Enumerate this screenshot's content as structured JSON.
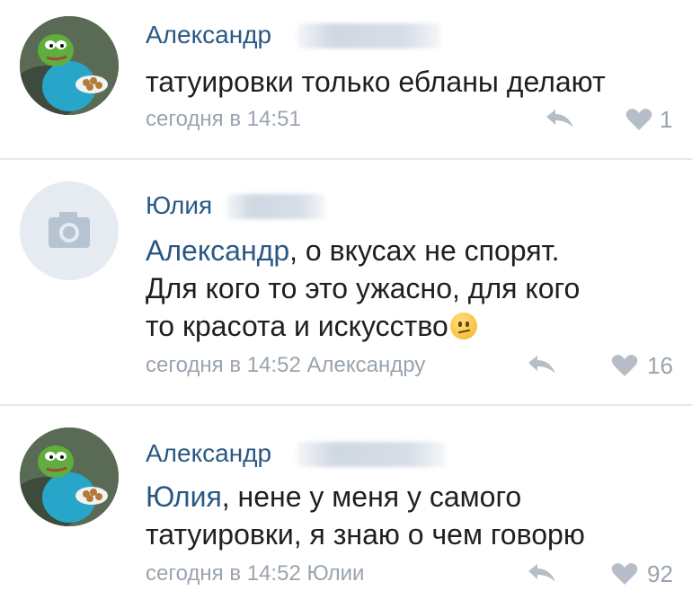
{
  "comments": [
    {
      "author": "Александр",
      "text_lines": [
        "татуировки только ебланы делают"
      ],
      "timestamp": "сегодня в 14:51",
      "likes": "1",
      "avatar": "pepe-frog-avatar"
    },
    {
      "author": "Юлия",
      "mention": "Александр",
      "text_lines": [
        ", о вкусах не спорят.",
        "Для кого то это ужасно,  для кого",
        "то красота и искусство"
      ],
      "emoji": "confused-face-emoji",
      "timestamp": "сегодня в 14:52 Александру",
      "likes": "16",
      "avatar": "camera-placeholder-avatar"
    },
    {
      "author": "Александр",
      "mention": "Юлия",
      "text_lines": [
        ", нене у меня у самого",
        "татуировки, я знаю о чем говорю"
      ],
      "timestamp": "сегодня в 14:52 Юлии",
      "likes": "92",
      "avatar": "pepe-frog-avatar"
    }
  ],
  "colors": {
    "link": "#2a5885",
    "meta": "#9aa4ae",
    "text": "#1f1f1f",
    "divider": "#e6e8ea"
  }
}
